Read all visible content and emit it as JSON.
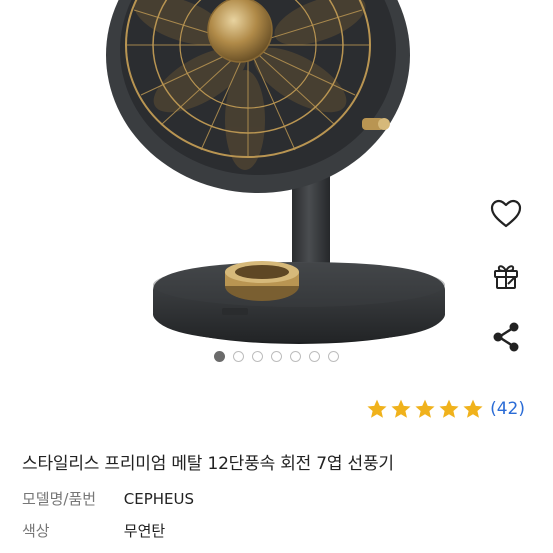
{
  "product": {
    "title": "스타일리스 프리미엄 메탈 12단풍속 회전 7엽 선풍기",
    "rating": {
      "stars": 5,
      "count_label": "(42)"
    },
    "specs": [
      {
        "key": "모델명/품번",
        "value": "CEPHEUS"
      },
      {
        "key": "색상",
        "value": "무연탄"
      }
    ]
  },
  "gallery": {
    "image_count": 7,
    "active_index": 0
  },
  "actions": {
    "wishlist_icon": "heart-icon",
    "gift_icon": "gift-icon",
    "share_icon": "share-icon"
  },
  "colors": {
    "star": "#f0b21c",
    "link": "#2b6cd6",
    "fan_body": "#3a3d40",
    "fan_gold": "#b99552"
  }
}
